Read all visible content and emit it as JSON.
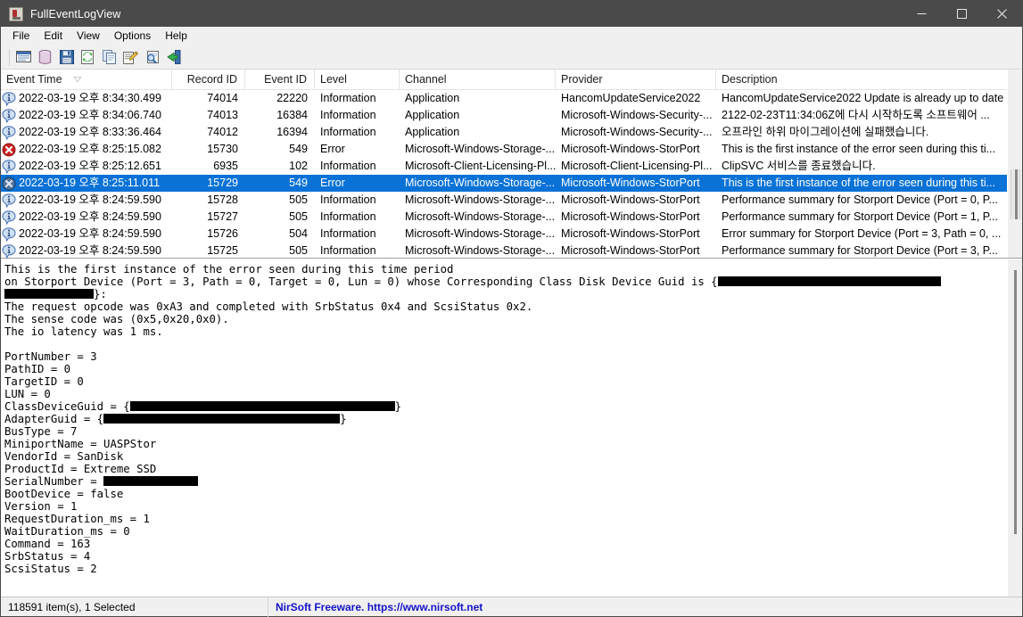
{
  "window": {
    "title": "FullEventLogView",
    "app_icon": "event-log-icon",
    "minimize_label": "Minimize",
    "maximize_label": "Maximize",
    "close_label": "Close"
  },
  "menubar": {
    "items": [
      {
        "label": "File"
      },
      {
        "label": "Edit"
      },
      {
        "label": "View"
      },
      {
        "label": "Options"
      },
      {
        "label": "Help"
      }
    ]
  },
  "toolbar": {
    "buttons": [
      {
        "icon": "select-event-sources-icon",
        "label": "Select Event Sources"
      },
      {
        "icon": "database-icon",
        "label": "Load Event Logs"
      },
      {
        "icon": "save-icon",
        "label": "Save Selected Items"
      },
      {
        "icon": "refresh-icon",
        "label": "Refresh"
      },
      {
        "icon": "copy-icon",
        "label": "Copy Selected Items"
      },
      {
        "icon": "properties-icon",
        "label": "Properties"
      },
      {
        "icon": "find-icon",
        "label": "Find"
      },
      {
        "icon": "exit-icon",
        "label": "Exit"
      }
    ]
  },
  "grid": {
    "columns": [
      {
        "key": "time",
        "label": "Event Time",
        "align": "left",
        "sorted": true,
        "sort_glyph": "sort-ascending-icon"
      },
      {
        "key": "record_id",
        "label": "Record ID",
        "align": "right"
      },
      {
        "key": "event_id",
        "label": "Event ID",
        "align": "right"
      },
      {
        "key": "level",
        "label": "Level",
        "align": "left"
      },
      {
        "key": "channel",
        "label": "Channel",
        "align": "left"
      },
      {
        "key": "provider",
        "label": "Provider",
        "align": "left"
      },
      {
        "key": "description",
        "label": "Description",
        "align": "left"
      }
    ],
    "rows": [
      {
        "icon": "information-icon",
        "time": "2022-03-19 오후 8:34:30.499",
        "record_id": "74014",
        "event_id": "22220",
        "level": "Information",
        "channel": "Application",
        "provider": "HancomUpdateService2022",
        "description": "HancomUpdateService2022 Update is already up to date",
        "selected": false
      },
      {
        "icon": "information-icon",
        "time": "2022-03-19 오후 8:34:06.740",
        "record_id": "74013",
        "event_id": "16384",
        "level": "Information",
        "channel": "Application",
        "provider": "Microsoft-Windows-Security-...",
        "description": "2122-02-23T11:34:06Z에 다시 시작하도록 소프트웨어 ...",
        "selected": false
      },
      {
        "icon": "information-icon",
        "time": "2022-03-19 오후 8:33:36.464",
        "record_id": "74012",
        "event_id": "16394",
        "level": "Information",
        "channel": "Application",
        "provider": "Microsoft-Windows-Security-...",
        "description": "오프라인 하위 마이그레이션에 실패했습니다.",
        "selected": false
      },
      {
        "icon": "error-icon",
        "time": "2022-03-19 오후 8:25:15.082",
        "record_id": "15730",
        "event_id": "549",
        "level": "Error",
        "channel": "Microsoft-Windows-Storage-...",
        "provider": "Microsoft-Windows-StorPort",
        "description": "This is the first instance of the error seen during this ti...",
        "selected": false
      },
      {
        "icon": "information-icon",
        "time": "2022-03-19 오후 8:25:12.651",
        "record_id": "6935",
        "event_id": "102",
        "level": "Information",
        "channel": "Microsoft-Client-Licensing-Pl...",
        "provider": "Microsoft-Client-Licensing-Pl...",
        "description": "ClipSVC 서비스를 종료했습니다.",
        "selected": false
      },
      {
        "icon": "error-icon-selected",
        "time": "2022-03-19 오후 8:25:11.011",
        "record_id": "15729",
        "event_id": "549",
        "level": "Error",
        "channel": "Microsoft-Windows-Storage-...",
        "provider": "Microsoft-Windows-StorPort",
        "description": "This is the first instance of the error seen during this ti...",
        "selected": true
      },
      {
        "icon": "information-icon",
        "time": "2022-03-19 오후 8:24:59.590",
        "record_id": "15728",
        "event_id": "505",
        "level": "Information",
        "channel": "Microsoft-Windows-Storage-...",
        "provider": "Microsoft-Windows-StorPort",
        "description": "Performance summary for Storport Device (Port = 0, P...",
        "selected": false
      },
      {
        "icon": "information-icon",
        "time": "2022-03-19 오후 8:24:59.590",
        "record_id": "15727",
        "event_id": "505",
        "level": "Information",
        "channel": "Microsoft-Windows-Storage-...",
        "provider": "Microsoft-Windows-StorPort",
        "description": "Performance summary for Storport Device (Port = 1, P...",
        "selected": false
      },
      {
        "icon": "information-icon",
        "time": "2022-03-19 오후 8:24:59.590",
        "record_id": "15726",
        "event_id": "504",
        "level": "Information",
        "channel": "Microsoft-Windows-Storage-...",
        "provider": "Microsoft-Windows-StorPort",
        "description": "Error summary for Storport Device (Port = 3, Path = 0, ...",
        "selected": false
      },
      {
        "icon": "information-icon",
        "time": "2022-03-19 오후 8:24:59.590",
        "record_id": "15725",
        "event_id": "505",
        "level": "Information",
        "channel": "Microsoft-Windows-Storage-...",
        "provider": "Microsoft-Windows-StorPort",
        "description": "Performance summary for Storport Device (Port = 3, P...",
        "selected": false
      }
    ]
  },
  "detail": {
    "lines": [
      {
        "text": "This is the first instance of the error seen during this time period"
      },
      {
        "pre": "on Storport Device (Port = 3, Path = 0, Target = 0, Lun = 0) whose Corresponding Class Disk Device Guid is {",
        "redact": 250,
        "post": ""
      },
      {
        "pre": "",
        "redact": 100,
        "post": "}:"
      },
      {
        "text": "The request opcode was 0xA3 and completed with SrbStatus 0x4 and ScsiStatus 0x2."
      },
      {
        "text": "The sense code was (0x5,0x20,0x0)."
      },
      {
        "text": "The io latency was 1 ms."
      },
      {
        "text": ""
      },
      {
        "text": "PortNumber = 3"
      },
      {
        "text": "PathID = 0"
      },
      {
        "text": "TargetID = 0"
      },
      {
        "text": "LUN = 0"
      },
      {
        "pre": "ClassDeviceGuid = {",
        "redact": 297,
        "post": "}"
      },
      {
        "pre": "AdapterGuid = {",
        "redact": 265,
        "post": "}"
      },
      {
        "text": "BusType = 7"
      },
      {
        "text": "MiniportName = UASPStor"
      },
      {
        "text": "VendorId = SanDisk"
      },
      {
        "text": "ProductId = Extreme SSD"
      },
      {
        "pre": "SerialNumber = ",
        "redact": 106,
        "post": ""
      },
      {
        "text": "BootDevice = false"
      },
      {
        "text": "Version = 1"
      },
      {
        "text": "RequestDuration_ms = 1"
      },
      {
        "text": "WaitDuration_ms = 0"
      },
      {
        "text": "Command = 163"
      },
      {
        "text": "SrbStatus = 4"
      },
      {
        "text": "ScsiStatus = 2"
      }
    ]
  },
  "statusbar": {
    "item_count": "118591 item(s), 1 Selected",
    "credit": "NirSoft Freeware. https://www.nirsoft.net"
  },
  "colors": {
    "titlebar": "#4a4a4a",
    "selection": "#0a72d6",
    "chrome": "#f0f0f0",
    "credit_link": "#1414c8",
    "error_icon": "#cc2020",
    "info_icon": "#4a74b8"
  }
}
